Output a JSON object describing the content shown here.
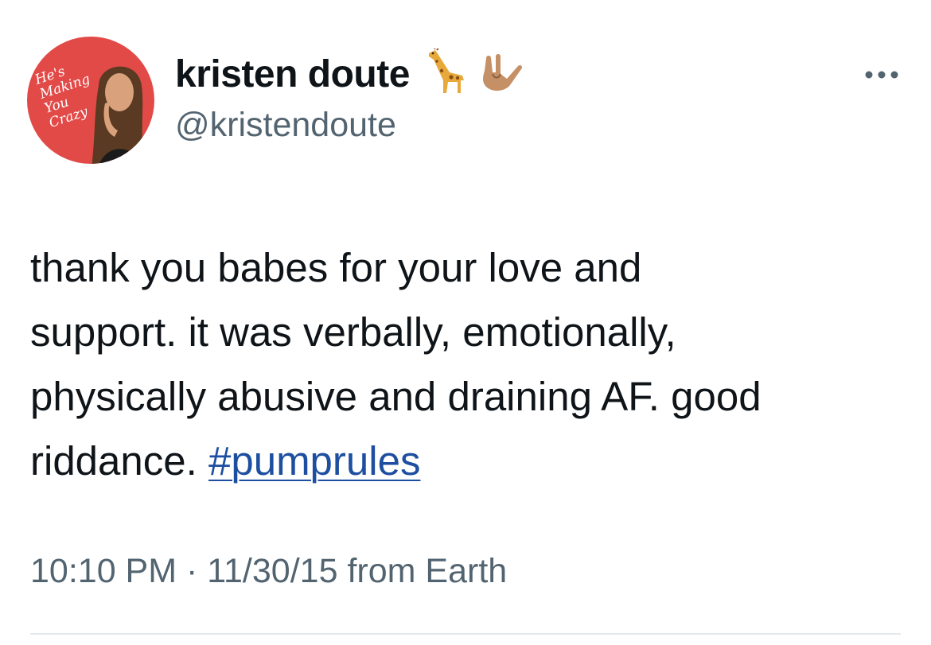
{
  "author": {
    "display_name": "kristen doute",
    "handle": "@kristendoute",
    "name_emojis": [
      "giraffe-icon",
      "love-you-hand-icon"
    ],
    "avatar_text": "He's Making You Crazy"
  },
  "tweet": {
    "text_lines": [
      "thank you babes for your love and",
      "support. it was verbally, emotionally,",
      "physically abusive and draining AF. good",
      "riddance. "
    ],
    "hashtag": "#pumprules",
    "timestamp": "10:10 PM",
    "date": "11/30/15",
    "separator": "·",
    "source": "from Earth"
  },
  "colors": {
    "text": "#0f1419",
    "secondary": "#536471",
    "link": "#1d4ea0",
    "avatar_bg": "#e24a48",
    "divider": "#e6e9eb"
  }
}
